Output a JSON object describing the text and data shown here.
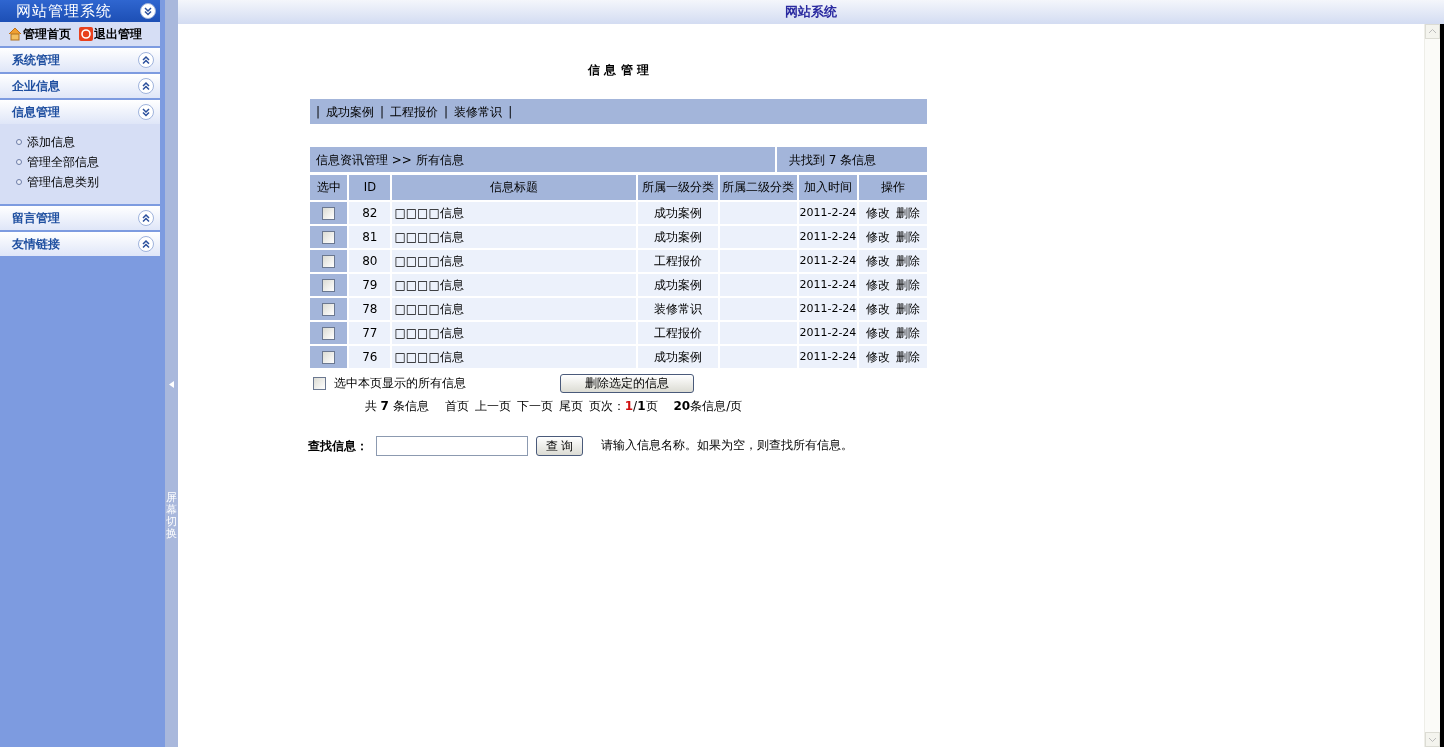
{
  "sidebar": {
    "title": "网站管理系统",
    "quick_links": [
      {
        "kind": "home",
        "label": "管理首页"
      },
      {
        "kind": "exit",
        "label": "退出管理"
      }
    ],
    "sections": [
      {
        "label": "系统管理",
        "expanded": false
      },
      {
        "label": "企业信息",
        "expanded": false
      },
      {
        "label": "信息管理",
        "expanded": true,
        "items": [
          "添加信息",
          "管理全部信息",
          "管理信息类别"
        ]
      },
      {
        "label": "留言管理",
        "expanded": false
      },
      {
        "label": "友情链接",
        "expanded": false
      }
    ]
  },
  "splitter": {
    "label": "屏幕切换"
  },
  "top_bar": {
    "title": "网站系统"
  },
  "page_title": "信 息 管 理",
  "category_tabs": {
    "separator": "|",
    "items": [
      "成功案例",
      "工程报价",
      "装修常识"
    ]
  },
  "breadcrumb": "信息资讯管理 >> 所有信息",
  "found_count": "共找到 7 条信息",
  "table": {
    "columns": [
      "选中",
      "ID",
      "信息标题",
      "所属一级分类",
      "所属二级分类",
      "加入时间",
      "操作"
    ],
    "rows": [
      {
        "checked": false,
        "id": "82",
        "title": "□□□□信息",
        "category": "成功案例",
        "subcategory": "",
        "date": "2011-2-24",
        "actions": [
          "修改",
          "删除"
        ]
      },
      {
        "checked": false,
        "id": "81",
        "title": "□□□□信息",
        "category": "成功案例",
        "subcategory": "",
        "date": "2011-2-24",
        "actions": [
          "修改",
          "删除"
        ]
      },
      {
        "checked": false,
        "id": "80",
        "title": "□□□□信息",
        "category": "工程报价",
        "subcategory": "",
        "date": "2011-2-24",
        "actions": [
          "修改",
          "删除"
        ]
      },
      {
        "checked": false,
        "id": "79",
        "title": "□□□□信息",
        "category": "成功案例",
        "subcategory": "",
        "date": "2011-2-24",
        "actions": [
          "修改",
          "删除"
        ]
      },
      {
        "checked": false,
        "id": "78",
        "title": "□□□□信息",
        "category": "装修常识",
        "subcategory": "",
        "date": "2011-2-24",
        "actions": [
          "修改",
          "删除"
        ]
      },
      {
        "checked": false,
        "id": "77",
        "title": "□□□□信息",
        "category": "工程报价",
        "subcategory": "",
        "date": "2011-2-24",
        "actions": [
          "修改",
          "删除"
        ]
      },
      {
        "checked": false,
        "id": "76",
        "title": "□□□□信息",
        "category": "成功案例",
        "subcategory": "",
        "date": "2011-2-24",
        "actions": [
          "修改",
          "删除"
        ]
      }
    ]
  },
  "select_all": {
    "label": "选中本页显示的所有信息",
    "checked": false
  },
  "delete_button": "删除选定的信息",
  "pagination": {
    "total": "共 **7** 条信息",
    "links": [
      "首页",
      "上一页",
      "下一页",
      "尾页"
    ],
    "page_label": "页次：",
    "current_page": "1",
    "page_rest": "/**1**页",
    "per_page": "**20**条信息/页"
  },
  "search": {
    "label": "查找信息：",
    "button": "查 询",
    "hint": "请输入信息名称。如果为空，则查找所有信息。"
  }
}
